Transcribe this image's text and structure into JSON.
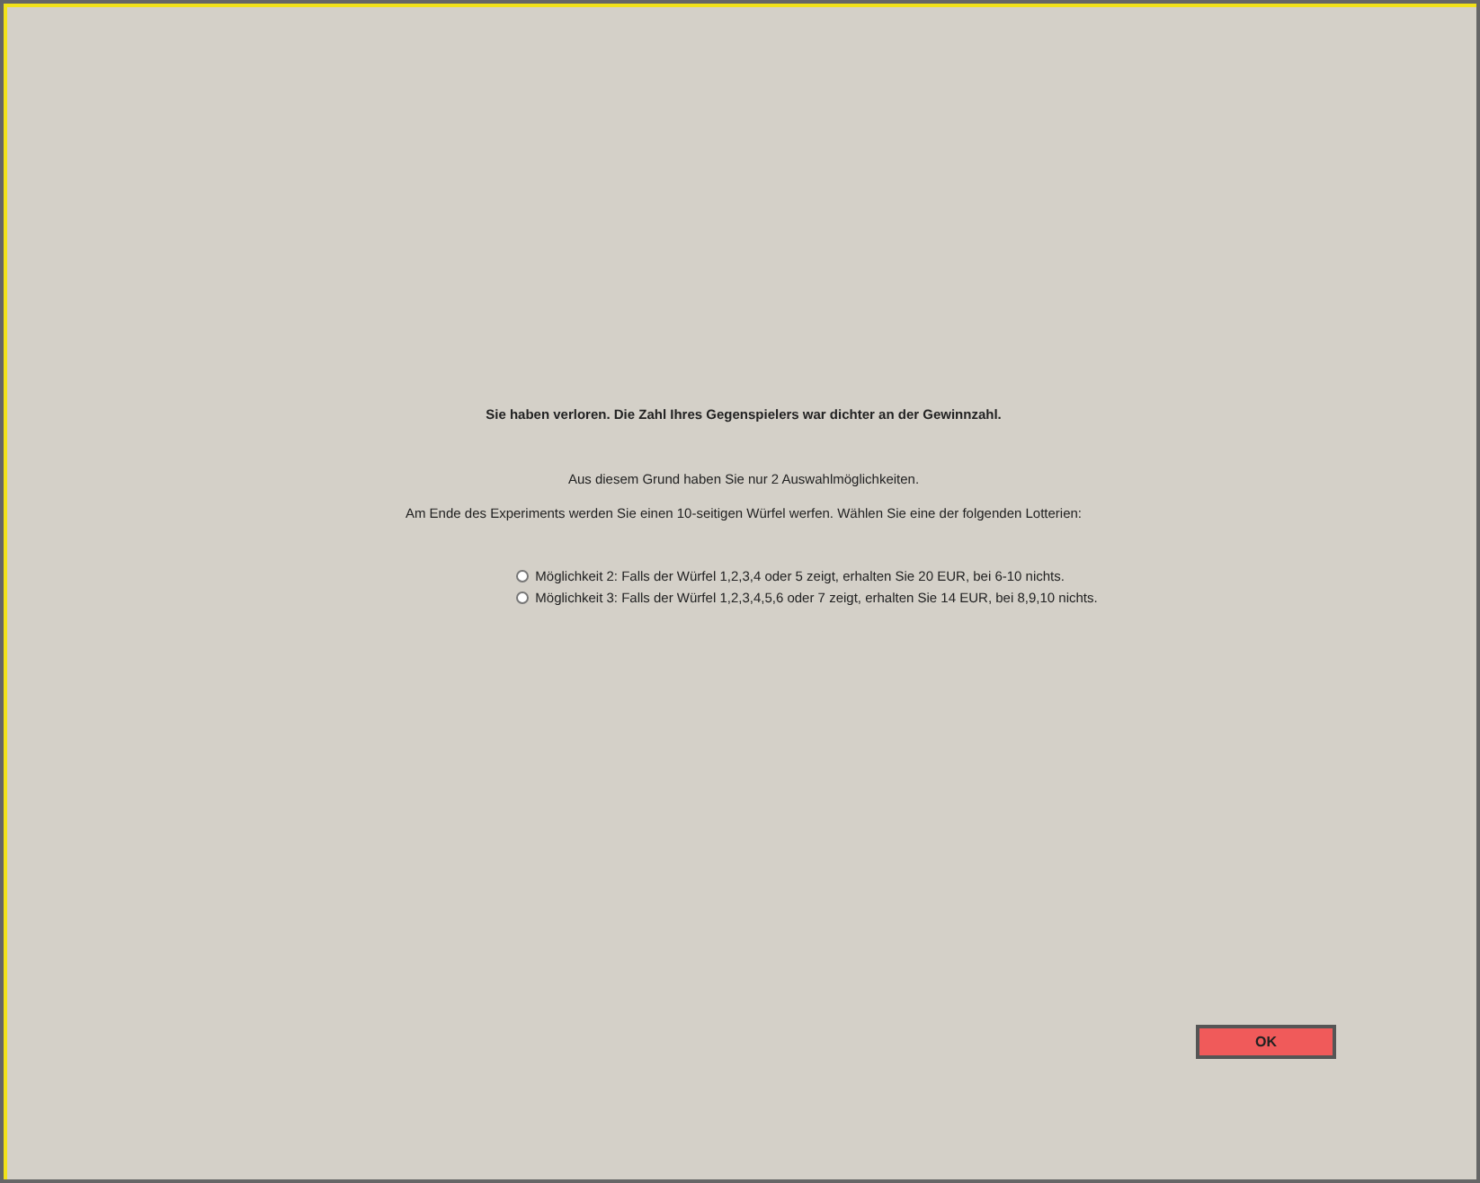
{
  "heading": "Sie haben verloren. Die Zahl Ihres Gegenspielers war dichter an der Gewinnzahl.",
  "lines": [
    "Aus diesem Grund haben Sie nur 2 Auswahlmöglichkeiten.",
    "Am Ende des Experiments werden Sie einen 10-seitigen Würfel werfen. Wählen Sie eine der folgenden Lotterien:"
  ],
  "options": [
    {
      "label": "Möglichkeit 2: Falls der Würfel 1,2,3,4 oder 5 zeigt, erhalten Sie 20 EUR, bei 6-10 nichts.",
      "selected": false
    },
    {
      "label": "Möglichkeit 3: Falls der Würfel 1,2,3,4,5,6 oder 7 zeigt, erhalten Sie 14 EUR, bei 8,9,10 nichts.",
      "selected": false
    }
  ],
  "ok_button": "OK"
}
